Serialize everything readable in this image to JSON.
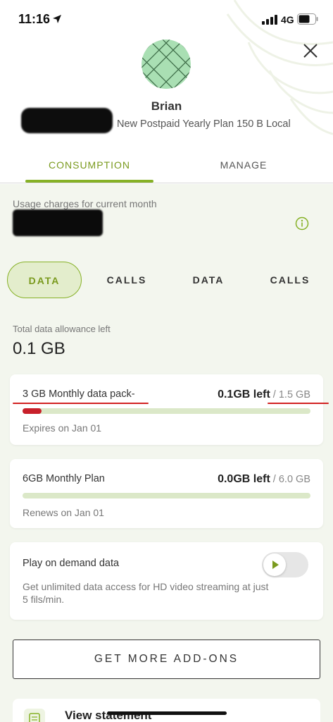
{
  "status_bar": {
    "time": "11:16",
    "network": "4G"
  },
  "profile": {
    "name": "Brian",
    "plan": "New Postpaid Yearly Plan 150 B Local"
  },
  "tabs": [
    {
      "label": "CONSUMPTION",
      "active": true
    },
    {
      "label": "MANAGE",
      "active": false
    }
  ],
  "usage": {
    "label": "Usage charges for current month"
  },
  "filters": [
    {
      "label": "DATA",
      "active": true
    },
    {
      "label": "CALLS",
      "active": false
    },
    {
      "label": "DATA",
      "active": false
    },
    {
      "label": "CALLS",
      "active": false
    }
  ],
  "allowance": {
    "label": "Total data allowance left",
    "value": "0.1 GB"
  },
  "packs": [
    {
      "name": "3 GB Monthly data pack-",
      "left": "0.1GB left",
      "total": "/ 1.5 GB",
      "date": "Expires on Jan 01",
      "remaining_fraction": 0.067,
      "bar_color": "#c8202a"
    },
    {
      "name": "6GB Monthly Plan",
      "left": "0.0GB left",
      "total": "/ 6.0 GB",
      "date": "Renews on Jan 01",
      "remaining_fraction": 0,
      "bar_color": "#86b126"
    }
  ],
  "on_demand": {
    "title": "Play on demand data",
    "description": "Get unlimited data access for HD video streaming at just 5 fils/min.",
    "enabled": false
  },
  "addons_button": "GET MORE ADD-ONS",
  "statement": {
    "label": "View statement"
  },
  "colors": {
    "accent": "#86b126",
    "accent_text": "#7a9a1e",
    "background": "#f3f6ee",
    "alert": "#c8202a"
  },
  "icons": [
    "location-arrow-icon",
    "signal-icon",
    "battery-icon",
    "close-icon",
    "info-icon",
    "play-icon",
    "statement-icon"
  ]
}
